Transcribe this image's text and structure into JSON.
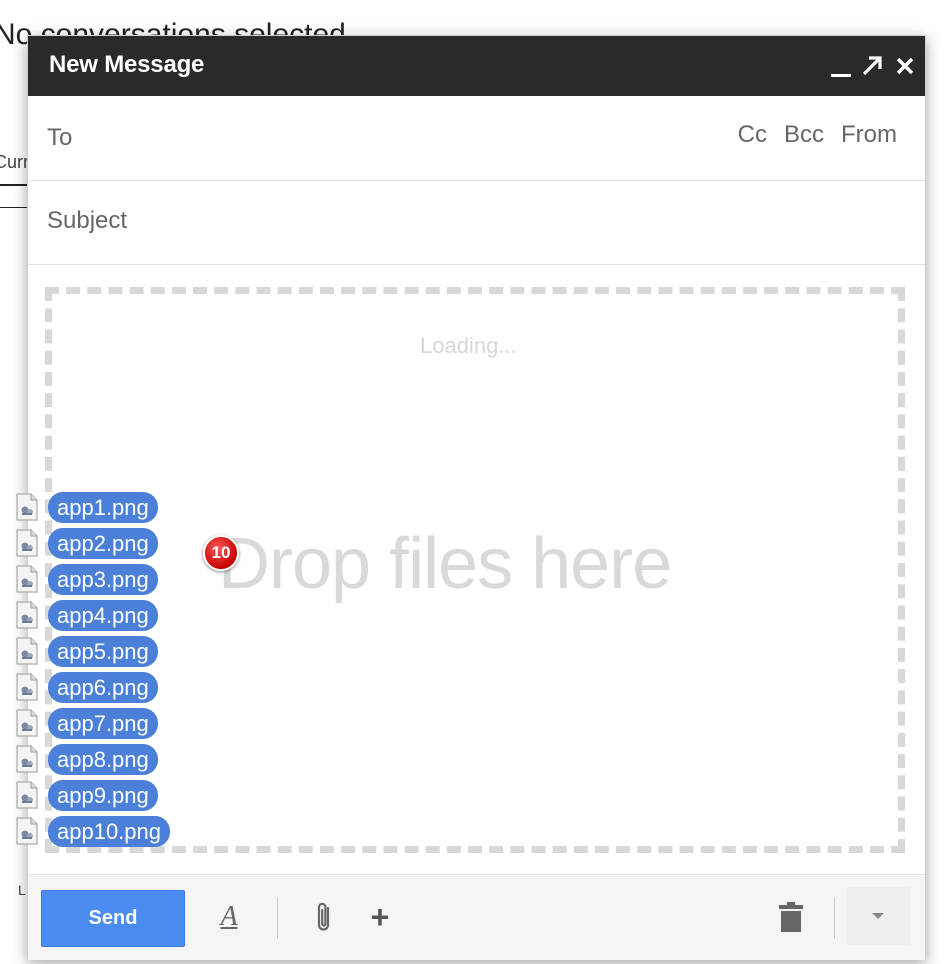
{
  "background": {
    "heading": "No conversations selected",
    "fragment": "Curr",
    "footer_fragment": "L"
  },
  "compose": {
    "title": "New Message",
    "to_label": "To",
    "cc_label": "Cc",
    "bcc_label": "Bcc",
    "from_label": "From",
    "subject_placeholder": "Subject",
    "body_loading": "Loading...",
    "drop_text": "Drop files here",
    "send_label": "Send"
  },
  "drag": {
    "count": "10",
    "files": [
      "app1.png",
      "app2.png",
      "app3.png",
      "app4.png",
      "app5.png",
      "app6.png",
      "app7.png",
      "app8.png",
      "app9.png",
      "app10.png"
    ]
  },
  "icons": {
    "minimize": "minimize-icon",
    "popout": "pop-out-arrow-icon",
    "close": "close-icon",
    "formatting": "text-formatting-icon",
    "attach": "paperclip-icon",
    "more_options": "plus-icon",
    "discard": "trash-icon",
    "more": "chevron-down-icon",
    "file": "image-file-icon"
  },
  "colors": {
    "titlebar": "#2a2a2a",
    "send_button": "#4a8cf0",
    "file_pill": "#4b7fd8",
    "badge": "#d10000"
  }
}
